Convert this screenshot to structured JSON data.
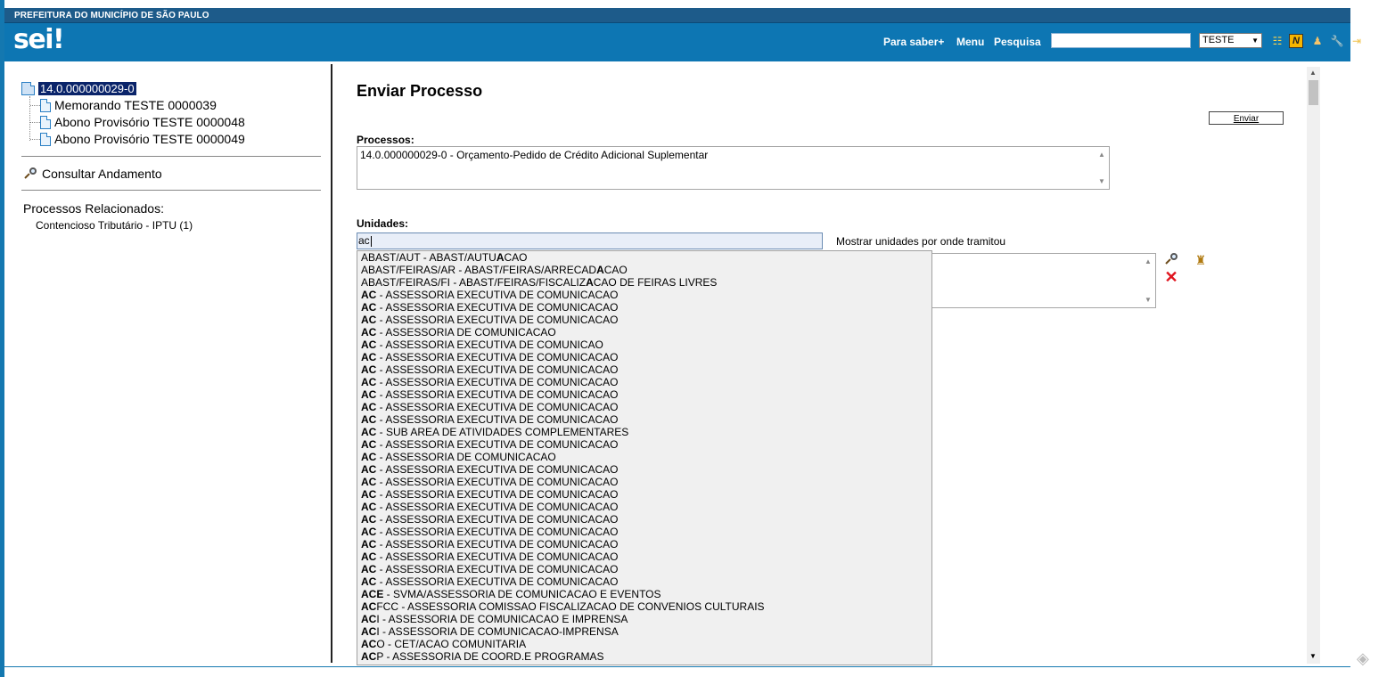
{
  "header": {
    "gov_title": "PREFEITURA DO MUNICÍPIO DE SÃO PAULO",
    "logo": "sei!",
    "links": [
      "Para saber+",
      "Menu",
      "Pesquisa"
    ],
    "search_value": "",
    "unit_selected": "TESTE",
    "icons": [
      "list-view-icon",
      "notes-icon",
      "user-icon",
      "tools-icon",
      "exit-icon"
    ]
  },
  "tree": {
    "root": "14.0.000000029-0",
    "children": [
      "Memorando TESTE 0000039",
      "Abono Provisório TESTE 0000048",
      "Abono Provisório TESTE 0000049"
    ],
    "consultar": "Consultar Andamento",
    "related_label": "Processos Relacionados:",
    "related_items": [
      "Contencioso Tributário - IPTU (1)"
    ]
  },
  "form": {
    "title": "Enviar Processo",
    "enviar_button": "Enviar",
    "processos_label": "Processos:",
    "processos_items": [
      "14.0.000000029-0 - Orçamento-Pedido de Crédito Adicional Suplementar"
    ],
    "unidades_label": "Unidades:",
    "unidades_input": "ac",
    "mostrar_label": "Mostrar unidades por onde tramitou"
  },
  "autocomplete": [
    {
      "pre": "ABAST/AUT - ABAST/AUTU",
      "hl": "A",
      "post": "CAO"
    },
    {
      "pre": "ABAST/FEIRAS/AR - ABAST/FEIRAS/ARRECAD",
      "hl": "A",
      "post": "CAO"
    },
    {
      "pre": "ABAST/FEIRAS/FI - ABAST/FEIRAS/FISCALIZ",
      "hl": "A",
      "post": "CAO DE FEIRAS LIVRES"
    },
    {
      "pre": "",
      "hl": "AC",
      "post": " - ASSESSORIA EXECUTIVA DE COMUNICACAO"
    },
    {
      "pre": "",
      "hl": "AC",
      "post": " - ASSESSORIA EXECUTIVA DE COMUNICACAO"
    },
    {
      "pre": "",
      "hl": "AC",
      "post": " - ASSESSORIA EXECUTIVA DE COMUNICACAO"
    },
    {
      "pre": "",
      "hl": "AC",
      "post": " - ASSESSORIA DE COMUNICACAO"
    },
    {
      "pre": "",
      "hl": "AC",
      "post": " - ASSESSORIA EXECUTIVA DE COMUNICAO"
    },
    {
      "pre": "",
      "hl": "AC",
      "post": " - ASSESSORIA EXECUTIVA DE COMUNICACAO"
    },
    {
      "pre": "",
      "hl": "AC",
      "post": " - ASSESSORIA EXECUTIVA DE COMUNICACAO"
    },
    {
      "pre": "",
      "hl": "AC",
      "post": " - ASSESSORIA EXECUTIVA DE COMUNICACAO"
    },
    {
      "pre": "",
      "hl": "AC",
      "post": " - ASSESSORIA EXECUTIVA DE COMUNICACAO"
    },
    {
      "pre": "",
      "hl": "AC",
      "post": " - ASSESSORIA EXECUTIVA DE COMUNICACAO"
    },
    {
      "pre": "",
      "hl": "AC",
      "post": " - ASSESSORIA EXECUTIVA DE COMUNICACAO"
    },
    {
      "pre": "",
      "hl": "AC",
      "post": " - SUB AREA DE ATIVIDADES COMPLEMENTARES"
    },
    {
      "pre": "",
      "hl": "AC",
      "post": " - ASSESSORIA EXECUTIVA DE COMUNICACAO"
    },
    {
      "pre": "",
      "hl": "AC",
      "post": " - ASSESSORIA DE COMUNICACAO"
    },
    {
      "pre": "",
      "hl": "AC",
      "post": " - ASSESSORIA EXECUTIVA DE COMUNICACAO"
    },
    {
      "pre": "",
      "hl": "AC",
      "post": " - ASSESSORIA EXECUTIVA DE COMUNICACAO"
    },
    {
      "pre": "",
      "hl": "AC",
      "post": " - ASSESSORIA EXECUTIVA DE COMUNICACAO"
    },
    {
      "pre": "",
      "hl": "AC",
      "post": " - ASSESSORIA EXECUTIVA DE COMUNICACAO"
    },
    {
      "pre": "",
      "hl": "AC",
      "post": " - ASSESSORIA EXECUTIVA DE COMUNICACAO"
    },
    {
      "pre": "",
      "hl": "AC",
      "post": " - ASSESSORIA EXECUTIVA DE COMUNICACAO"
    },
    {
      "pre": "",
      "hl": "AC",
      "post": " - ASSESSORIA EXECUTIVA DE COMUNICACAO"
    },
    {
      "pre": "",
      "hl": "AC",
      "post": " - ASSESSORIA EXECUTIVA DE COMUNICACAO"
    },
    {
      "pre": "",
      "hl": "AC",
      "post": " - ASSESSORIA EXECUTIVA DE COMUNICACAO"
    },
    {
      "pre": "",
      "hl": "AC",
      "post": " - ASSESSORIA EXECUTIVA DE COMUNICACAO"
    },
    {
      "pre": "",
      "hl": "ACE",
      "post": " - SVMA/ASSESSORIA DE COMUNICACAO E EVENTOS"
    },
    {
      "pre": "",
      "hl": "AC",
      "post": "FCC - ASSESSORIA COMISSAO FISCALIZACAO DE CONVENIOS CULTURAIS"
    },
    {
      "pre": "",
      "hl": "AC",
      "post": "I - ASSESSORIA DE COMUNICACAO E IMPRENSA"
    },
    {
      "pre": "",
      "hl": "AC",
      "post": "I - ASSESSORIA DE COMUNICACAO-IMPRENSA"
    },
    {
      "pre": "",
      "hl": "AC",
      "post": "O - CET/ACAO COMUNITARIA"
    },
    {
      "pre": "",
      "hl": "AC",
      "post": "P - ASSESSORIA DE COORD.E PROGRAMAS"
    }
  ]
}
